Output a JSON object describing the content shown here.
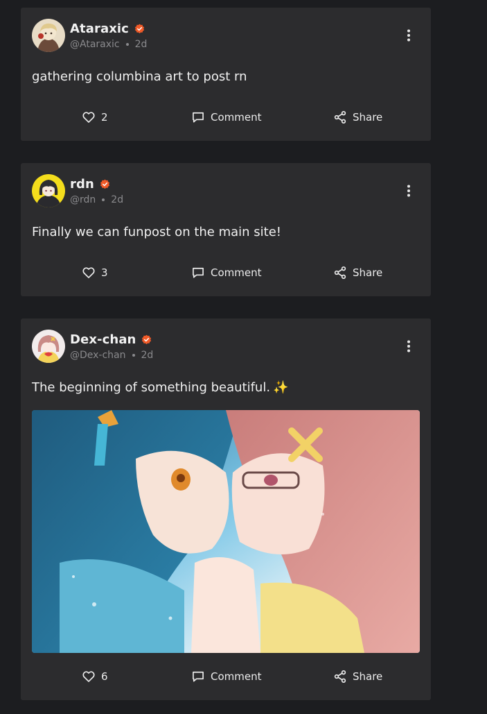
{
  "posts": [
    {
      "display_name": "Ataraxic",
      "handle": "@Ataraxic",
      "time": "2d",
      "text": "gathering columbina art to post rn",
      "likes": "2",
      "comment_label": "Comment",
      "share_label": "Share"
    },
    {
      "display_name": "rdn",
      "handle": "@rdn",
      "time": "2d",
      "text": "Finally we can funpost on the main site!",
      "likes": "3",
      "comment_label": "Comment",
      "share_label": "Share"
    },
    {
      "display_name": "Dex-chan",
      "handle": "@Dex-chan",
      "time": "2d",
      "text": "The beginning of something beautiful.",
      "emoji": "✨",
      "likes": "6",
      "comment_label": "Comment",
      "share_label": "Share"
    }
  ],
  "icons": {
    "verified": "verified-badge-icon",
    "more": "more-vertical-icon",
    "like": "heart-icon",
    "comment": "comment-icon",
    "share": "share-icon"
  },
  "colors": {
    "background": "#1c1d20",
    "card": "#2c2c2e",
    "verified": "#f05a28",
    "muted_text": "#8a8a8d"
  }
}
